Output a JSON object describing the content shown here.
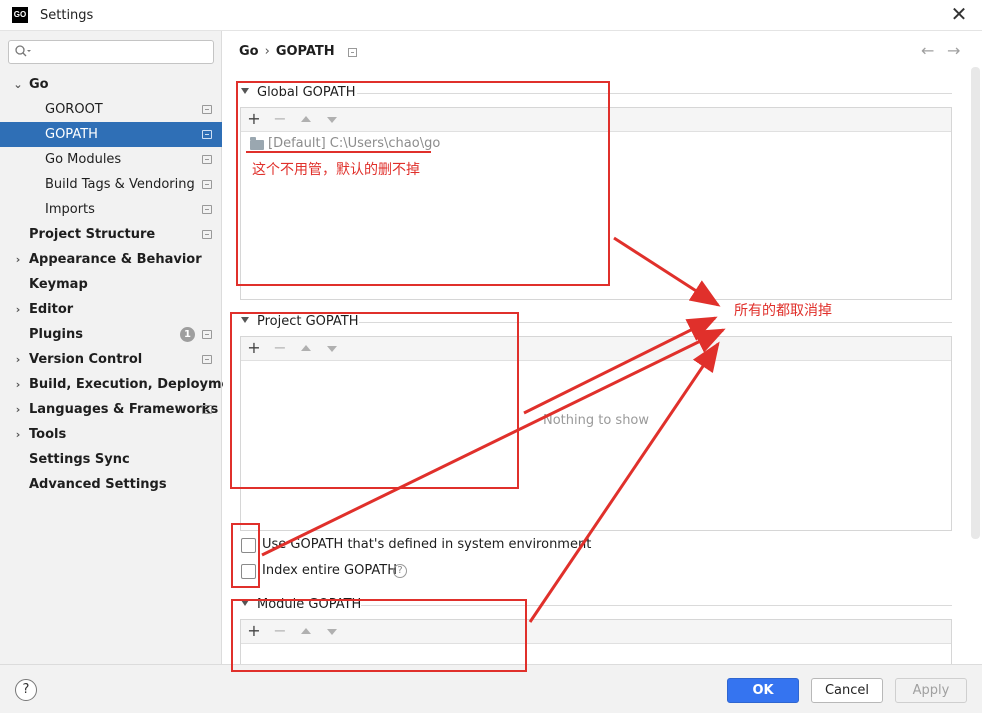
{
  "window": {
    "title": "Settings",
    "app_icon_text": "GO",
    "close_glyph": "✕"
  },
  "search": {
    "placeholder": "",
    "icon": "search-icon"
  },
  "sidebar": {
    "items": [
      {
        "label": "Go",
        "expanded": true
      },
      {
        "label": "GOROOT"
      },
      {
        "label": "GOPATH",
        "selected": true
      },
      {
        "label": "Go Modules"
      },
      {
        "label": "Build Tags & Vendoring"
      },
      {
        "label": "Imports"
      },
      {
        "label": "Project Structure"
      },
      {
        "label": "Appearance & Behavior"
      },
      {
        "label": "Keymap"
      },
      {
        "label": "Editor"
      },
      {
        "label": "Plugins",
        "badge": "1"
      },
      {
        "label": "Version Control"
      },
      {
        "label": "Build, Execution, Deployment"
      },
      {
        "label": "Languages & Frameworks"
      },
      {
        "label": "Tools"
      },
      {
        "label": "Settings Sync"
      },
      {
        "label": "Advanced Settings"
      }
    ]
  },
  "breadcrumb": {
    "parent": "Go",
    "separator": "›",
    "current": "GOPATH",
    "back_glyph": "←",
    "forward_glyph": "→"
  },
  "sections": {
    "global": {
      "title": "Global GOPATH",
      "entries": [
        "[Default] C:\\Users\\chao\\go"
      ]
    },
    "project": {
      "title": "Project GOPATH",
      "empty_text": "Nothing to show"
    },
    "module": {
      "title": "Module GOPATH"
    }
  },
  "toolbar": {
    "add": "+",
    "remove": "−"
  },
  "checkboxes": {
    "use_system": {
      "label": "Use GOPATH that's defined in system environment",
      "checked": false
    },
    "index_entire": {
      "label": "Index entire GOPATH",
      "checked": false,
      "help": "?"
    }
  },
  "footer": {
    "help": "?",
    "ok": "OK",
    "cancel": "Cancel",
    "apply": "Apply"
  },
  "annotations": {
    "global_note": "这个不用管，默认的删不掉",
    "target_note": "所有的都取消掉",
    "color": "#e0302b"
  }
}
